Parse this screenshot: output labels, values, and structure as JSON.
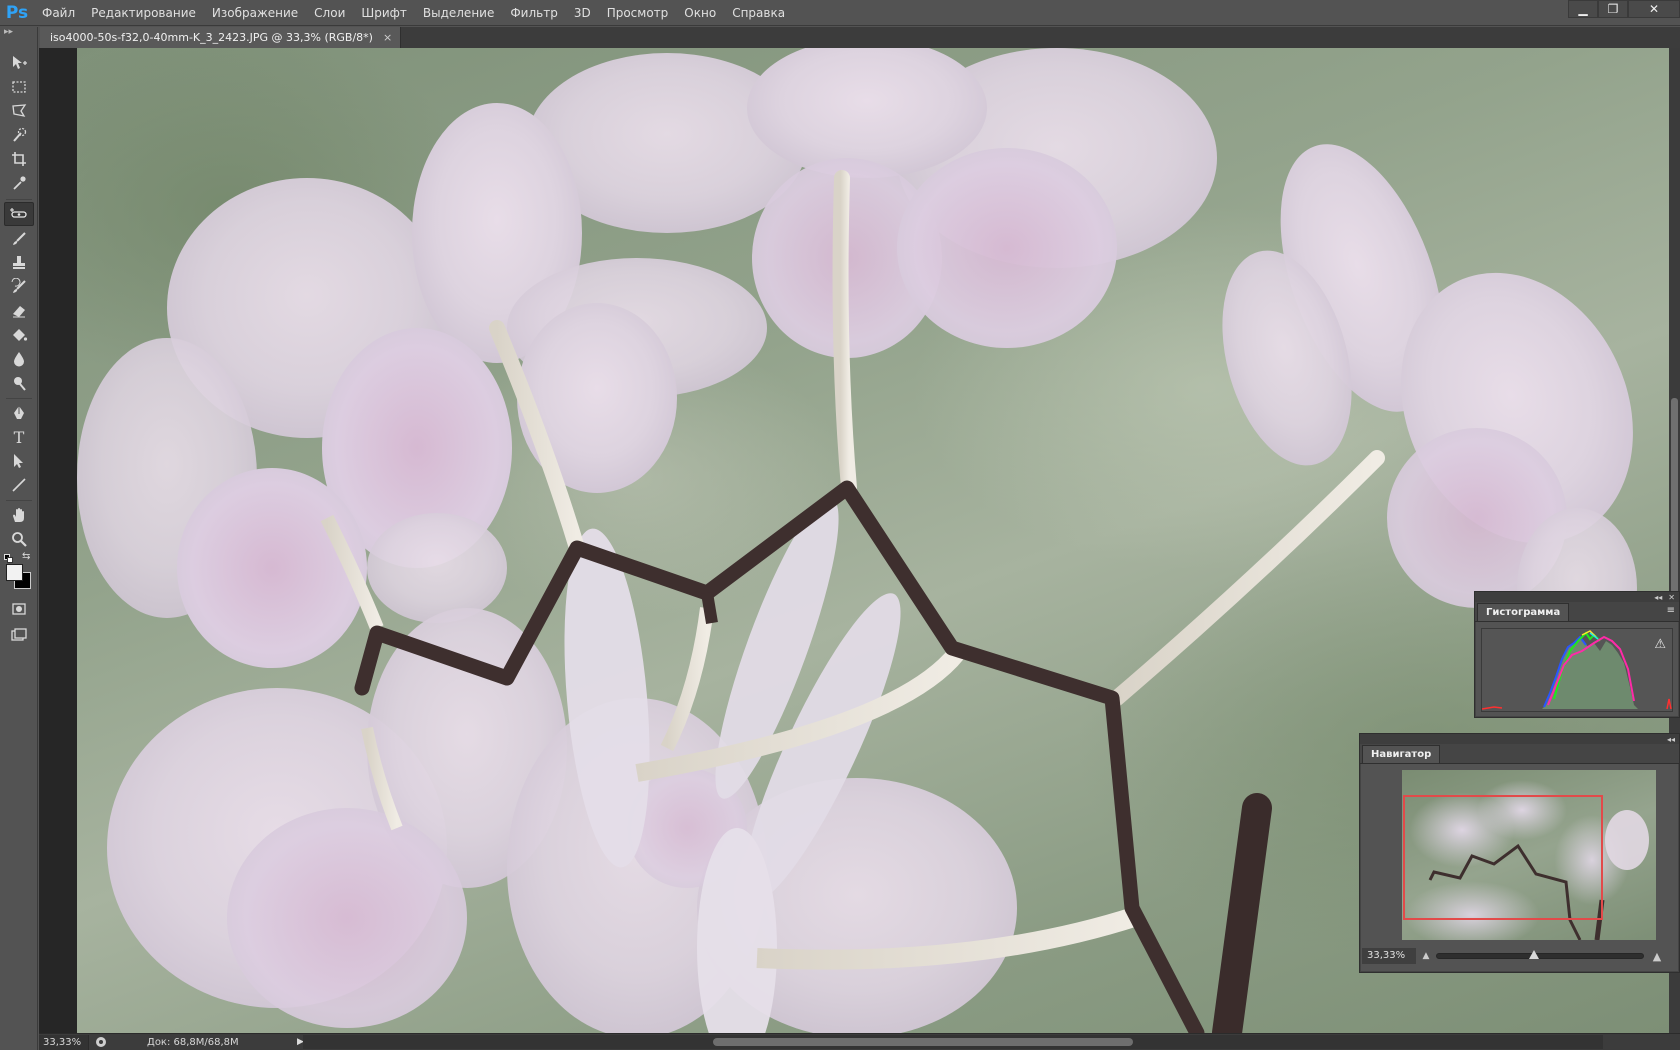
{
  "app": {
    "logo": "Ps",
    "menu": [
      "Файл",
      "Редактирование",
      "Изображение",
      "Слои",
      "Шрифт",
      "Выделение",
      "Фильтр",
      "3D",
      "Просмотр",
      "Окно",
      "Справка"
    ],
    "window_controls": {
      "minimize": "▁",
      "restore": "❐",
      "close": "✕"
    }
  },
  "document": {
    "tab_title": "iso4000-50s-f32,0-40mm-K_3_2423.JPG @ 33,3% (RGB/8*)",
    "tab_close": "×"
  },
  "toolbar": {
    "grip": "▸▸",
    "tools": [
      {
        "name": "move-tool",
        "icon": "move-icon"
      },
      {
        "name": "marquee-tool",
        "icon": "rectangle-marquee-icon"
      },
      {
        "name": "lasso-tool",
        "icon": "polygonal-lasso-icon"
      },
      {
        "name": "quick-selection-tool",
        "icon": "quick-selection-icon"
      },
      {
        "name": "crop-tool",
        "icon": "crop-icon"
      },
      {
        "name": "eyedropper-tool",
        "icon": "eyedropper-icon"
      },
      {
        "name": "spot-healing-tool",
        "icon": "spot-healing-icon",
        "active": true
      },
      {
        "name": "brush-tool",
        "icon": "brush-icon"
      },
      {
        "name": "clone-stamp-tool",
        "icon": "stamp-icon"
      },
      {
        "name": "history-brush-tool",
        "icon": "history-brush-icon"
      },
      {
        "name": "eraser-tool",
        "icon": "eraser-icon"
      },
      {
        "name": "paint-bucket-tool",
        "icon": "bucket-icon"
      },
      {
        "name": "blur-tool",
        "icon": "blur-drop-icon"
      },
      {
        "name": "dodge-tool",
        "icon": "dodge-icon"
      },
      {
        "name": "pen-tool",
        "icon": "pen-icon"
      },
      {
        "name": "type-tool",
        "icon": "type-icon",
        "glyph": "T"
      },
      {
        "name": "path-selection-tool",
        "icon": "path-selection-icon"
      },
      {
        "name": "line-tool",
        "icon": "line-icon"
      },
      {
        "name": "hand-tool",
        "icon": "hand-icon"
      },
      {
        "name": "zoom-tool",
        "icon": "zoom-icon"
      }
    ],
    "foreground_color": "#f2f2f2",
    "background_color": "#000000"
  },
  "statusbar": {
    "zoom": "33,33%",
    "doc_info": "Док: 68,8M/68,8M",
    "arrow": "▶",
    "scroll_left": "◂"
  },
  "histogram": {
    "title": "Гистограмма",
    "menu_icon": "≡",
    "warning": "⚠",
    "collapse": "◂◂",
    "close": "✕"
  },
  "navigator": {
    "title": "Навигатор",
    "zoom": "33,33%",
    "zoom_out": "▲",
    "zoom_in": "▲",
    "collapse": "◂◂",
    "proxy_color": "#e24a4a"
  }
}
